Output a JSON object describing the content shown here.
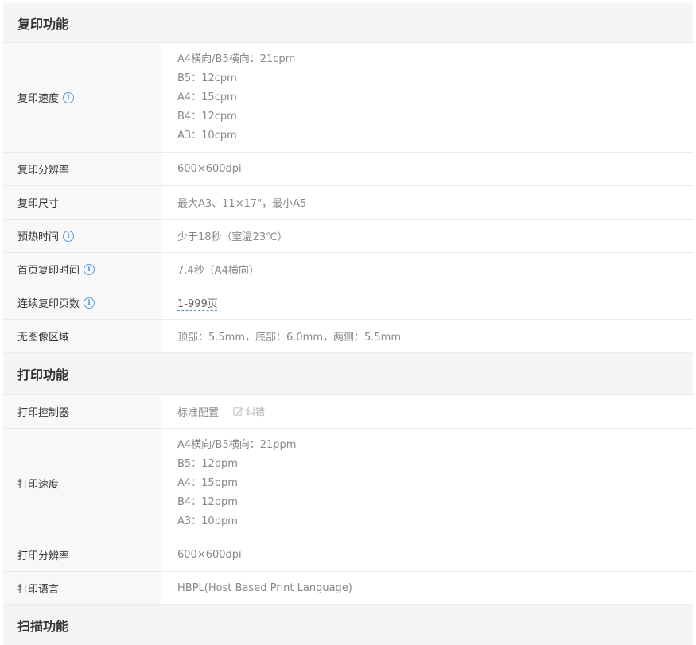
{
  "sections": {
    "copy": {
      "title": "复印功能",
      "rows": {
        "speed": {
          "label": "复印速度",
          "values": [
            "A4横向/B5横向：21cpm",
            "B5：12cpm",
            "A4：15cpm",
            "B4：12cpm",
            "A3：10cpm"
          ]
        },
        "resolution": {
          "label": "复印分辨率",
          "value": "600×600dpi"
        },
        "size": {
          "label": "复印尺寸",
          "value": "最大A3、11×17\"，最小A5"
        },
        "warmup": {
          "label": "预热时间",
          "value": "少于18秒（室温23℃）"
        },
        "first_copy": {
          "label": "首页复印时间",
          "value": "7.4秒（A4横向）"
        },
        "continuous": {
          "label": "连续复印页数",
          "value": "1-999页"
        },
        "no_image_area": {
          "label": "无图像区域",
          "value": "顶部：5.5mm，底部：6.0mm，两侧：5.5mm"
        }
      }
    },
    "print": {
      "title": "打印功能",
      "rows": {
        "controller": {
          "label": "打印控制器",
          "value": "标准配置",
          "correction_label": "纠错"
        },
        "speed": {
          "label": "打印速度",
          "values": [
            "A4横向/B5横向：21ppm",
            "B5：12ppm",
            "A4：15ppm",
            "B4：12ppm",
            "A3：10ppm"
          ]
        },
        "resolution": {
          "label": "打印分辨率",
          "value": "600×600dpi"
        },
        "language": {
          "label": "打印语言",
          "value": "HBPL(Host Based Print Language)"
        }
      }
    },
    "scan": {
      "title": "扫描功能"
    }
  },
  "icons": {
    "info": "info-icon",
    "edit": "edit-icon"
  },
  "colors": {
    "info_icon": "#5a9bd5",
    "label_bg": "#f8f8f8",
    "header_bg": "#f5f5f5",
    "value_text": "#888888"
  }
}
